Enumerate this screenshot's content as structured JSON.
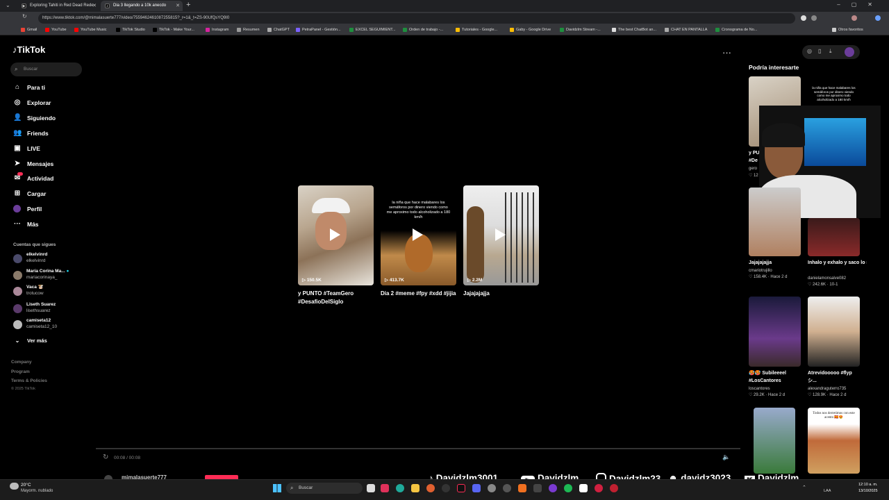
{
  "browser": {
    "tabs": [
      {
        "title": "Exploring Tahiti in Red Dead Rede"
      },
      {
        "title": "Dia 3 llegando a 10k anecdo"
      }
    ],
    "url": "https://www.tiktok.com/@mimalasuerte777/video/7559462461087255815?_r=1&_t=ZS-90UfQsYQ9I0",
    "bookmarks": [
      "Gmail",
      "YouTube",
      "YouTube Music",
      "TikTok Studio",
      "TikTok - Make Your...",
      "Instagram",
      "Resumen",
      "ChatGPT",
      "PetraPanel - Gestión...",
      "EXCEL SEGUIMIENT...",
      "Orden de trabajo -...",
      "Tutoriales - Google...",
      "Gaby - Google Drive",
      "Davidzlm Stream -...",
      "The best ChatBot an...",
      "CHAT EN PANTALLA",
      "Cronograma de No..."
    ],
    "other_bookmarks": "Otros favoritos"
  },
  "sidebar": {
    "logo": "TikTok",
    "search_placeholder": "Buscar",
    "nav": [
      "Para ti",
      "Explorar",
      "Siguiendo",
      "Friends",
      "LIVE",
      "Mensajes",
      "Actividad",
      "Cargar",
      "Perfil",
      "Más"
    ],
    "following_header": "Cuentas que sigues",
    "following": [
      {
        "nick": "elkelvinrd",
        "user": "elkelvinrd"
      },
      {
        "nick": "María Corina Ma...",
        "user": "mariacorinaya_"
      },
      {
        "nick": "Vaca 🐮",
        "user": "trotucow"
      },
      {
        "nick": "Liseth Suarez",
        "user": "lisethsuarez"
      },
      {
        "nick": "camiseta12",
        "user": "camiseta12_10"
      }
    ],
    "see_more": "Ver más",
    "footer": [
      "Company",
      "Program",
      "Terms & Policies",
      "© 2025 TikTok"
    ]
  },
  "main": {
    "videos": [
      {
        "views": "150.5K",
        "title": "y PUNTO #TeamGero #DesafioDelSiglo",
        "caption": ""
      },
      {
        "views": "413.7K",
        "title": "Dia 2 #meme #fpy #xdd #jijia",
        "caption": "la niña que hace malabares los semáforos por dinero viendo como me aproximo todo alcoholizado a 180 km/h"
      },
      {
        "views": "2.2M",
        "title": "Jajajajajja",
        "caption": ""
      }
    ],
    "time": "00:08 / 00:08",
    "author": "mimalasuerte777"
  },
  "right": {
    "header": "Podría interesarte",
    "cards": [
      {
        "title": "y PUNTO",
        "title2": "#De",
        "user": "gero",
        "stats": "♡ 12"
      },
      {
        "title": "",
        "caption": "la niña que hace malabares los semáforos por dinero viendo como me aproximo todo alcoholizado a 180 km/h"
      },
      {
        "title": "Jajajajajja",
        "user": "cmariotrujillo",
        "stats": "♡ 158.4K · Hace 2 d"
      },
      {
        "title": "Inhalo y exhalo y saco lo malo. ✨...",
        "user": "danielamonsalve082",
        "stats": "♡ 242.6K · 10-1"
      },
      {
        "title": "🥵🥵 Subileeeel",
        "title2": "#LosCantores",
        "user": "loscantores",
        "stats": "♡ 29.2K · Hace 2 d"
      },
      {
        "title": "Atrevidooooo #flyp",
        "title2": "シ...",
        "user": "alexandraguterro735",
        "stats": "♡ 128.9K · Hace 2 d"
      },
      {
        "title": "",
        "caption": ""
      },
      {
        "title": "",
        "caption": "Todos nos derretimos con este acento 🇪🇸😍"
      }
    ]
  },
  "taskbar": {
    "weather_temp": "20°C",
    "weather_desc": "Mayorm. nublado",
    "search": "Buscar",
    "lang": "LAA",
    "time": "12:10 a. m.",
    "date": "13/10/2025"
  },
  "overlay": {
    "tiktok": "Davidzlm3001",
    "youtube": "Davidzlm",
    "instagram": "Davidzlm23",
    "discord": "davidz3023",
    "kick": "Davidzlm"
  },
  "colors": {
    "accent": "#fe2c55",
    "bg": "#000000",
    "chrome": "#35363a"
  }
}
